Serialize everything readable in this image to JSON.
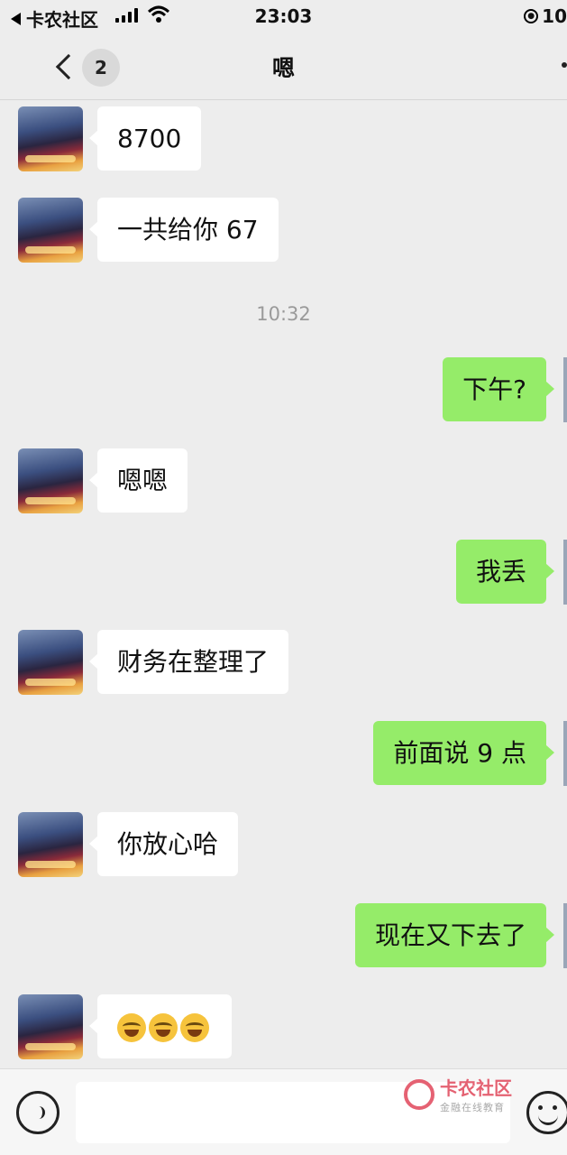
{
  "status": {
    "back_app": "卡农社区",
    "time": "23:03",
    "battery": "10"
  },
  "nav": {
    "unread": "2",
    "title": "嗯"
  },
  "messages": [
    {
      "side": "left",
      "text": "8700"
    },
    {
      "side": "left",
      "text": "一共给你 67"
    },
    {
      "side": "right",
      "text": "下午?"
    },
    {
      "side": "left",
      "text": "嗯嗯"
    },
    {
      "side": "right",
      "text": "我丢"
    },
    {
      "side": "left",
      "text": "财务在整理了"
    },
    {
      "side": "right",
      "text": "前面说 9 点"
    },
    {
      "side": "left",
      "text": "你放心哈"
    },
    {
      "side": "right",
      "text": "现在又下去了"
    },
    {
      "side": "left",
      "text": "",
      "emoji": [
        "crying-laughing-emoji",
        "crying-laughing-emoji",
        "crying-laughing-emoji"
      ]
    }
  ],
  "timestamp": "10:32",
  "watermark": {
    "name": "卡农社区",
    "sub": "金融在线教育"
  },
  "colors": {
    "background": "#ededed",
    "outgoing_bubble": "#95ec69",
    "incoming_bubble": "#ffffff"
  }
}
